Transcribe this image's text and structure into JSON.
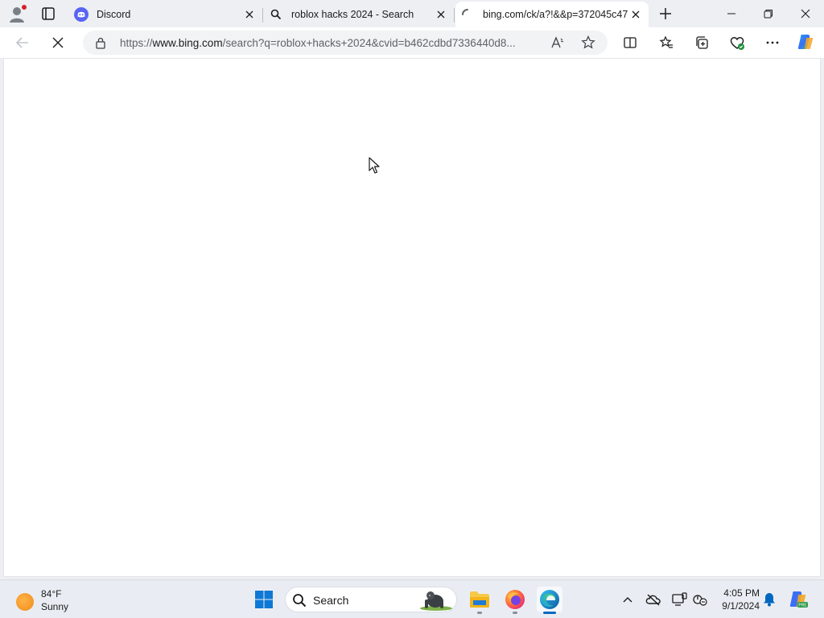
{
  "browser": {
    "tabs": [
      {
        "title": "Discord",
        "favicon": "discord-icon",
        "active": false
      },
      {
        "title": "roblox hacks 2024 - Search",
        "favicon": "search-icon",
        "active": false
      },
      {
        "title": "bing.com/ck/a?!&&p=372045c47",
        "favicon": "loading-spinner-icon",
        "active": true
      }
    ],
    "address_bar": {
      "url_prefix": "https://",
      "url_host": "www.bing.com",
      "url_rest": "/search?q=roblox+hacks+2024&cvid=b462cdbd7336440d8..."
    }
  },
  "taskbar": {
    "weather": {
      "temperature": "84°F",
      "condition": "Sunny"
    },
    "search_label": "Search",
    "clock": {
      "time": "4:05 PM",
      "date": "9/1/2024"
    }
  },
  "colors": {
    "accent": "#0067c0",
    "chrome_bg": "#edeff3",
    "discord": "#5865f2"
  }
}
